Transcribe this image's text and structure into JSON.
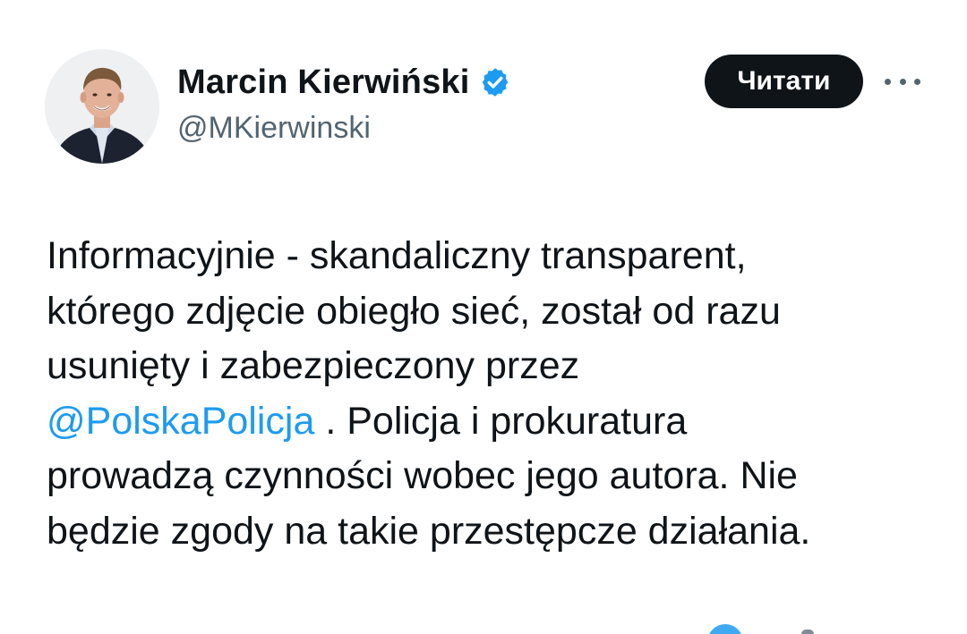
{
  "author": {
    "display_name": "Marcin Kierwiński",
    "handle": "@MKierwinski",
    "verified": true,
    "verified_color": "#1d9bf0",
    "avatar_icon": "profile-photo"
  },
  "actions": {
    "follow_label": "Читати",
    "more_icon": "more-horizontal-icon"
  },
  "tweet": {
    "line1": "Informacyjnie - skandaliczny transparent,",
    "line2": "którego zdjęcie obiegło sieć, został od razu",
    "line3": "usunięty i zabezpieczony przez",
    "mention": "@PolskaPolicja",
    "line4_rest": " . Policja i prokuratura",
    "line5": "prowadzą czynności wobec jego autora. Nie",
    "line6": "będzie zgody na takie przestępcze działania."
  },
  "colors": {
    "text": "#0f1419",
    "secondary": "#536471",
    "link": "#1d9bf0",
    "button_bg": "#0f1419"
  }
}
